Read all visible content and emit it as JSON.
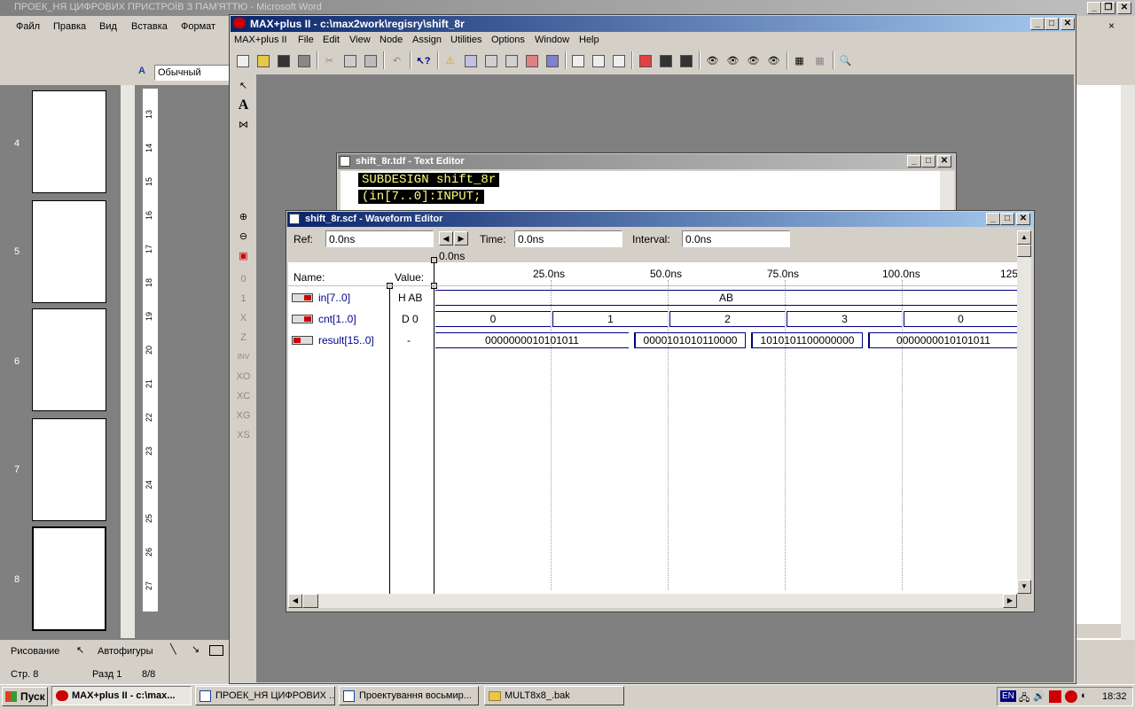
{
  "word": {
    "title": "ПРОЕК_НЯ ЦИФРОВИХ ПРИСТРОЇВ З ПАМ'ЯТТЮ - Microsoft Word",
    "menu": [
      "Файл",
      "Правка",
      "Вид",
      "Вставка",
      "Формат"
    ],
    "style_value": "Обычный",
    "pages": [
      "4",
      "5",
      "6",
      "7",
      "8"
    ],
    "ruler_marks": [
      "13",
      "14",
      "15",
      "16",
      "17",
      "18",
      "19",
      "20",
      "21",
      "22",
      "23",
      "24",
      "25",
      "26",
      "27"
    ],
    "drawing_label": "Рисование",
    "autoshapes_label": "Автофигуры",
    "status": {
      "page": "Стр. 8",
      "section": "Разд 1",
      "count": "8/8"
    }
  },
  "maxplus": {
    "title": "MAX+plus II - c:\\max2work\\regisry\\shift_8r",
    "menu": [
      "MAX+plus II",
      "File",
      "Edit",
      "View",
      "Node",
      "Assign",
      "Utilities",
      "Options",
      "Window",
      "Help"
    ],
    "palette_labels": [
      "A",
      "INV",
      "Z"
    ],
    "text_editor": {
      "title": "shift_8r.tdf - Text Editor",
      "lines": [
        "SUBDESIGN shift_8r",
        "(in[7..0]:INPUT;"
      ]
    },
    "waveform": {
      "title": "shift_8r.scf - Waveform Editor",
      "ref_label": "Ref:",
      "ref_value": "0.0ns",
      "time_label": "Time:",
      "time_value": "0.0ns",
      "interval_label": "Interval:",
      "interval_value": "0.0ns",
      "cursor_time": "0.0ns",
      "name_header": "Name:",
      "value_header": "Value:",
      "time_marks": [
        "25.0ns",
        "50.0ns",
        "75.0ns",
        "100.0ns",
        "125"
      ],
      "signals": [
        {
          "name": "in[7..0]",
          "value": "H AB",
          "segments": [
            "AB"
          ]
        },
        {
          "name": "cnt[1..0]",
          "value": "D 0",
          "segments": [
            "0",
            "1",
            "2",
            "3",
            "0"
          ]
        },
        {
          "name": "result[15..0]",
          "value": "-",
          "segments": [
            "0000000010101011",
            "0000101010110000",
            "1010101100000000",
            "0000000010101011"
          ]
        }
      ]
    }
  },
  "taskbar": {
    "start": "Пуск",
    "buttons": [
      "MAX+plus II - c:\\max...",
      "ПРОЕК_НЯ ЦИФРОВИХ ...",
      "Проектування восьмир...",
      "MULT8x8_.bak"
    ],
    "lang": "EN",
    "clock": "18:32"
  },
  "colors": {
    "title_active": "#0a246a",
    "title_inactive": "#808080",
    "signal_name": "#00008b",
    "pin_red": "#cc0000"
  }
}
